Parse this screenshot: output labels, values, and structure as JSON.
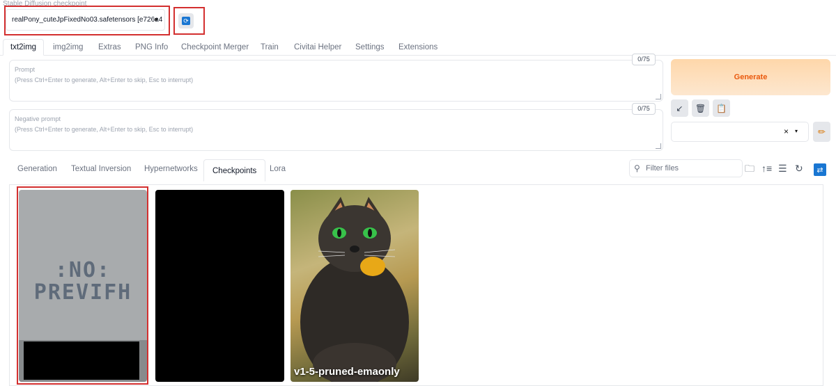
{
  "checkpoint": {
    "label": "Stable Diffusion checkpoint",
    "selected": "realPony_cuteJpFixedNo03.safetensors [e726a4"
  },
  "top_tabs": [
    "txt2img",
    "img2img",
    "Extras",
    "PNG Info",
    "Checkpoint Merger",
    "Train",
    "Civitai Helper",
    "Settings",
    "Extensions"
  ],
  "prompt": {
    "title": "Prompt",
    "placeholder": "(Press Ctrl+Enter to generate, Alt+Enter to skip, Esc to interrupt)",
    "counter": "0/75"
  },
  "negative_prompt": {
    "title": "Negative prompt",
    "placeholder": "(Press Ctrl+Enter to generate, Alt+Enter to skip, Esc to interrupt)",
    "counter": "0/75"
  },
  "generate": {
    "label": "Generate"
  },
  "styles": {
    "clear": "×",
    "caret": "▾"
  },
  "extra_tabs": [
    "Generation",
    "Textual Inversion",
    "Hypernetworks",
    "Checkpoints",
    "Lora"
  ],
  "filter": {
    "placeholder": "Filter files"
  },
  "cards": {
    "no_preview_text": ": NO :\nPREVIEW",
    "cat_name": "v1-5-pruned-emaonly"
  },
  "colors": {
    "highlight": "#d32f2f",
    "accent_blue": "#1976d2",
    "generate_text": "#ea580c"
  }
}
